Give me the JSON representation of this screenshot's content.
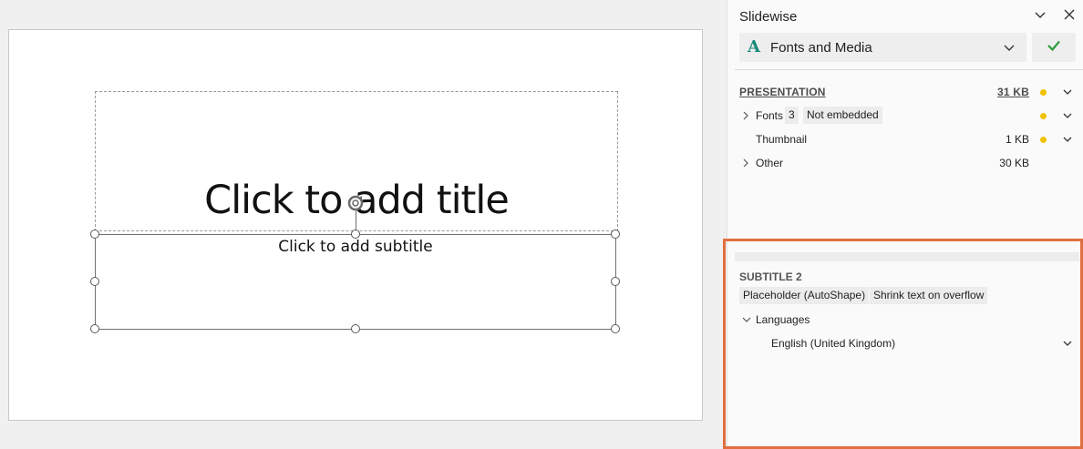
{
  "slide": {
    "title_placeholder": "Click to add title",
    "subtitle_placeholder": "Click to add subtitle"
  },
  "pane": {
    "title": "Slidewise",
    "selector": {
      "icon": "font-A-icon",
      "label": "Fonts and Media"
    },
    "presentation": {
      "heading": "PRESENTATION",
      "size": "31 KB",
      "rows": [
        {
          "label": "Fonts",
          "count": "3",
          "badge": "Not embedded",
          "size": ""
        },
        {
          "label": "Thumbnail",
          "size": "1 KB"
        },
        {
          "label": "Other",
          "size": "30 KB"
        }
      ]
    },
    "selection": {
      "heading": "SUBTITLE 2",
      "tags": [
        "Placeholder (AutoShape)",
        "Shrink text on overflow"
      ],
      "languages_label": "Languages",
      "languages": [
        "English (United Kingdom)"
      ]
    }
  },
  "colors": {
    "accent": "#e07040",
    "warning_dot": "#f2c200",
    "check": "#2e9b3e",
    "font_icon": "#1a8a78"
  }
}
